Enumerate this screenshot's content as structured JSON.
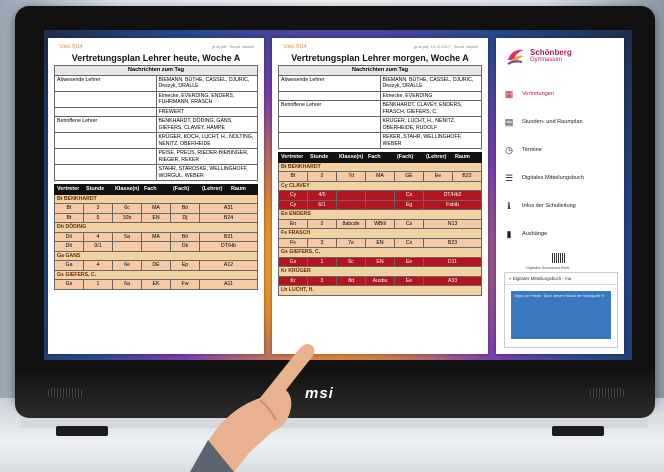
{
  "device": {
    "brand": "msi"
  },
  "today": {
    "org": "Unis 2014",
    "meta": "gt at pdf · Stand: aktuell",
    "title": "Vertretungsplan Lehrer heute, Woche A",
    "news_header": "Nachrichten zum Tag",
    "news": [
      {
        "who": "Abwesende Lehrer",
        "text": "BIEMANN, BÜTHE, CASSEL, DJURIC, Deszyk, DRALLE"
      },
      {
        "who": "",
        "text": "Eimecke, EVERDING, ENDERS, FUHRMANN, FRASCH"
      },
      {
        "who": "",
        "text": "FREWERT"
      },
      {
        "who": "Betroffene Lehrer",
        "text": "BENKHARDT, DÖDING, GANS, GIEFERS, CLAVEY, HAMPE"
      },
      {
        "who": "",
        "text": "KRÜGER, KOCH, LUCHT, H., NOLTING, NENITZ, OBERHEIDE"
      },
      {
        "who": "",
        "text": "PEISE, PREUS, RIEDER-BIEBINGER, RIEGER, REKER"
      },
      {
        "who": "",
        "text": "STAHR, STAROSKE, WELLINGHOFF, WORGUL, WEBER"
      }
    ],
    "sub_header": [
      "Vertreter",
      "Stunde",
      "Klasse(n)",
      "Fach",
      "(Fach)",
      "(Lehrer)",
      "Raum"
    ],
    "groups": [
      {
        "name": "Bt BENKHARDT",
        "style": "row",
        "rows": [
          [
            "Bt",
            "3",
            "6c",
            "",
            "MA",
            "Bö",
            "A31"
          ],
          [
            "Bt",
            "5",
            "10b",
            "",
            "EN",
            "Dj",
            "B24"
          ]
        ]
      },
      {
        "name": "Dö DÖDING",
        "style": "row",
        "rows": [
          [
            "Dö",
            "4",
            "5a",
            "",
            "MA",
            "Bö",
            "B21"
          ],
          [
            "Dö",
            "0/1",
            "",
            "",
            "",
            "Dk",
            "DT/Hb"
          ]
        ]
      },
      {
        "name": "Ga GANS",
        "style": "row",
        "rows": [
          [
            "Ga",
            "4",
            "6e",
            "",
            "DE",
            "Ep",
            "A12"
          ]
        ]
      },
      {
        "name": "Gs GIEFERS, C.",
        "style": "row",
        "rows": [
          [
            "Gs",
            "1",
            "6a",
            "",
            "EK",
            "Fw",
            "A11"
          ]
        ]
      }
    ]
  },
  "tomorrow": {
    "org": "Unis 2014",
    "meta": "gt at pdf, 14.11.2017 · Stand: aktuell",
    "title": "Vertretungsplan Lehrer morgen, Woche A",
    "news_header": "Nachrichten zum Tag",
    "news": [
      {
        "who": "Abwesende Lehrer",
        "text": "BIEMANN, BÜTHE, CASSEL, DJURIC, Deszyk, DRALLE"
      },
      {
        "who": "",
        "text": "Eimecke, EVERDING"
      },
      {
        "who": "Betroffene Lehrer",
        "text": "BENKHARDT, CLAVEY, ENDERS, FRASCH, GIEFERS, C."
      },
      {
        "who": "",
        "text": "KRÜGER, LUCHT, H., NENITZ, OBERHEIDE, RUDOLF"
      },
      {
        "who": "",
        "text": "REKER, STAHR, WELLINGHOFF, WEBER"
      }
    ],
    "sub_header": [
      "Vertreter",
      "Stunde",
      "Klasse(n)",
      "Fach",
      "(Fach)",
      "(Lehrer)",
      "Raum"
    ],
    "groups": [
      {
        "name": "Bt BENKHARDT",
        "style": "row",
        "rows": [
          [
            "Bt",
            "2",
            "7d",
            "",
            "MA",
            "GE",
            "Ee",
            "B22"
          ]
        ]
      },
      {
        "name": "Cy CLAVEY",
        "style": "red",
        "rows": [
          [
            "Cy",
            "4/5",
            "",
            "",
            "",
            "Cs",
            "DT/Hb2"
          ],
          [
            "Cy",
            "6/1",
            "",
            "",
            "",
            "Eg",
            "Fsbib"
          ]
        ]
      },
      {
        "name": "En ENDERS",
        "style": "row",
        "rows": [
          [
            "En",
            "2",
            "8abcde",
            "",
            "WBiii",
            "Cs",
            "N13"
          ]
        ]
      },
      {
        "name": "Fs FRASCH",
        "style": "row",
        "rows": [
          [
            "Fs",
            "3",
            "7e",
            "",
            "EN",
            "Cs",
            "B23"
          ]
        ]
      },
      {
        "name": "Gs GIEFERS, C.",
        "style": "red",
        "rows": [
          [
            "Gs",
            "1",
            "5c",
            "",
            "EN",
            "Ee",
            "D11"
          ]
        ]
      },
      {
        "name": "Kr KRÜGER",
        "style": "red",
        "rows": [
          [
            "Kr",
            "3",
            "8d",
            "",
            "Ausbu",
            "Ee",
            "A33"
          ]
        ]
      },
      {
        "name": "Lh LUCHT, H.",
        "style": "row",
        "rows": []
      }
    ]
  },
  "sidebar": {
    "logo_name": "Schönberg",
    "logo_sub": "Gymnasium",
    "items": [
      {
        "label": "Vertretungen",
        "icon": "grid-icon",
        "glyph": "▦"
      },
      {
        "label": "Stunden- und Raumplan",
        "icon": "calendar-icon",
        "glyph": "▤"
      },
      {
        "label": "Termine",
        "icon": "clock-icon",
        "glyph": "◷"
      },
      {
        "label": "Digitales Mitteilungsbuch",
        "icon": "list-icon",
        "glyph": "☰"
      },
      {
        "label": "Infos der Schulleitung",
        "icon": "info-icon",
        "glyph": "ℹ"
      },
      {
        "label": "Aushänge",
        "icon": "bookmark-icon",
        "glyph": "▮"
      }
    ],
    "qr_label": "Digitales Schwarzes Brett",
    "mini_title": "« Digitales Mitteilungsbuch - Ina",
    "mini_text": "Tipps von Frieda · Da in diesem Monat der Vortrag der 9 …"
  },
  "colors": {
    "accent": "#c01828",
    "row": "#f6c9a7",
    "group": "#f1d2a3",
    "header": "#111111"
  }
}
